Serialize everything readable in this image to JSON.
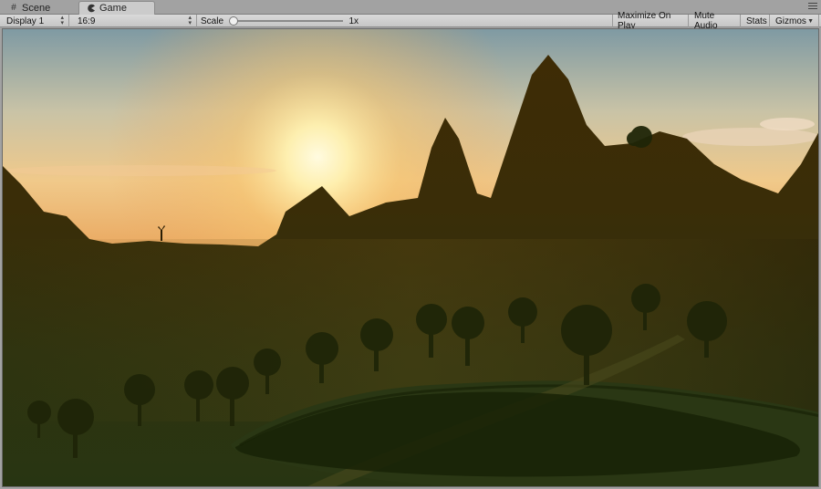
{
  "tabs": [
    {
      "label": "Scene",
      "icon": "grid-icon"
    },
    {
      "label": "Game",
      "icon": "pacman-icon"
    }
  ],
  "toolbar": {
    "display": "Display 1",
    "aspect": "16:9",
    "scale_label": "Scale",
    "scale_value": "1x",
    "maximize_label": "Maximize On Play",
    "mute_label": "Mute Audio",
    "stats_label": "Stats",
    "gizmos_label": "Gizmos"
  },
  "colors": {
    "sky_top": "#8fa3a8",
    "sun": "#fff6c8",
    "horizon": "#e8a860",
    "terrain_dark": "#3a2a06",
    "grass": "#2e3a12"
  }
}
